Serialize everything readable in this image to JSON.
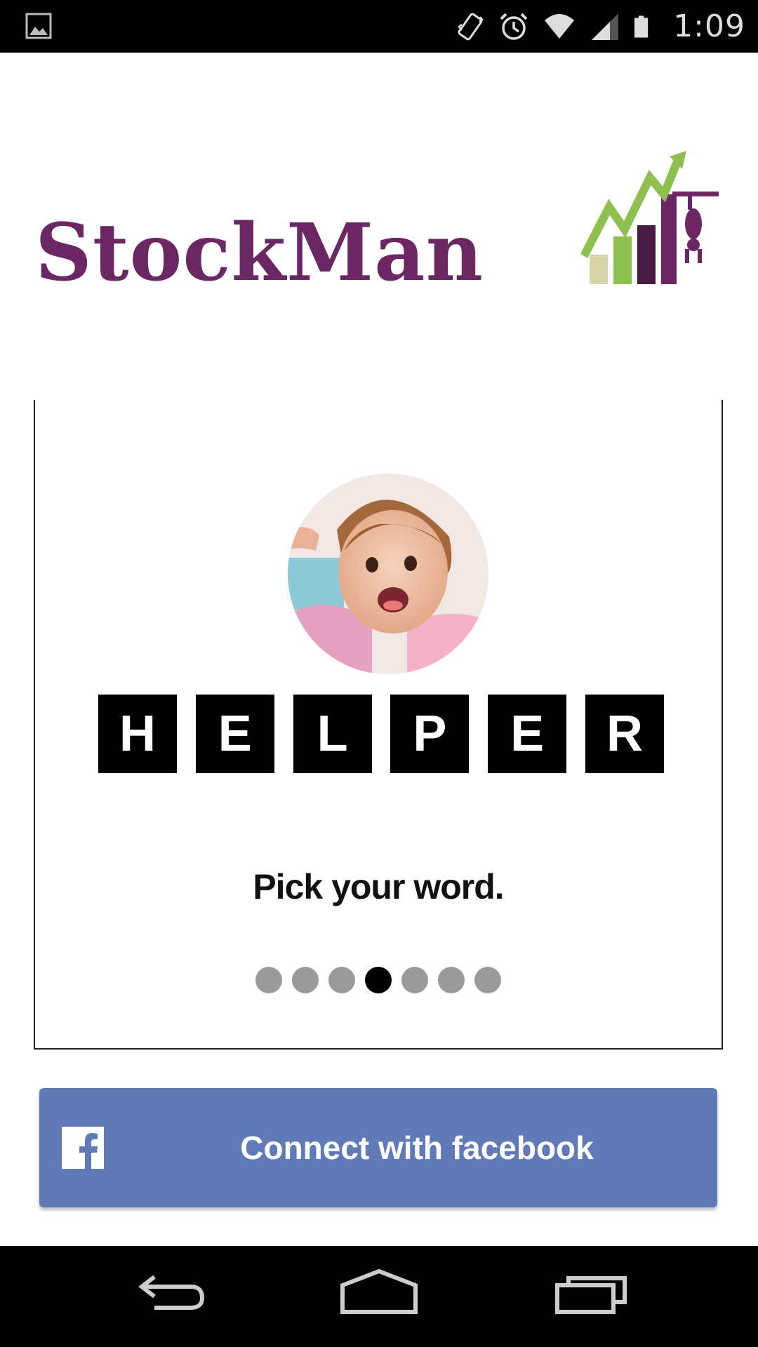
{
  "status_bar": {
    "time": "1:09",
    "icons": [
      "image-icon",
      "vibrate-icon",
      "alarm-icon",
      "wifi-icon",
      "signal-icon",
      "battery-icon"
    ]
  },
  "logo": {
    "text": "StockMan",
    "colors": {
      "text": "#6b2664",
      "arrow": "#8dc04f",
      "bar_light": "#d8d2a8",
      "bar_green": "#8dc04f",
      "bar_dark": "#4a1c44",
      "bar_purple": "#6b2664"
    }
  },
  "onboarding": {
    "word_tiles": [
      "H",
      "E",
      "L",
      "P",
      "E",
      "R"
    ],
    "tagline": "Pick your word.",
    "pager": {
      "total": 7,
      "active_index": 3
    }
  },
  "facebook_button": {
    "label": "Connect with facebook",
    "icon": "facebook-icon",
    "color": "#5f7ab6"
  },
  "nav_bar": {
    "buttons": [
      "back-icon",
      "home-icon",
      "recents-icon"
    ]
  }
}
